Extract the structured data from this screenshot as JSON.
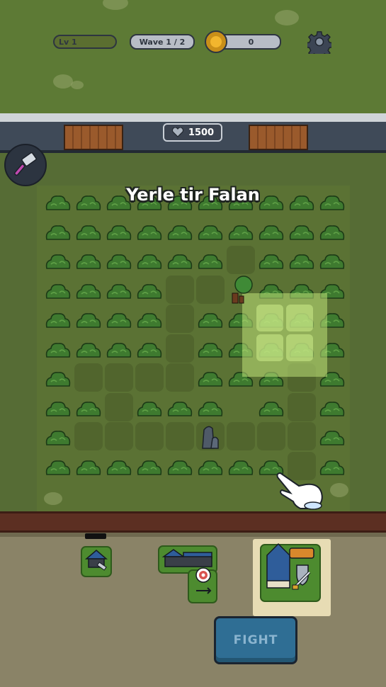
{
  "hud": {
    "level_label": "Lv 1",
    "wave_label": "Wave 1 / 2",
    "coins": "0",
    "settings_icon": "gear-icon"
  },
  "wall": {
    "health": "1500",
    "health_icon": "heart-icon"
  },
  "board": {
    "instruction": "Yerle tir Falan"
  },
  "cards": [
    {
      "name": "builder-hut",
      "icon": "hammer-hut-icon"
    },
    {
      "name": "archer-camp",
      "icon": "archery-target-icon"
    },
    {
      "name": "barracks",
      "icon": "shield-sword-icon",
      "selected": true
    }
  ],
  "actions": {
    "fight_label": "FIGHT"
  },
  "colors": {
    "field": "#5b7234",
    "placement": "#bee178",
    "fight_button": "#2f6e94",
    "selected_card_bg": "#e7dcb4"
  }
}
